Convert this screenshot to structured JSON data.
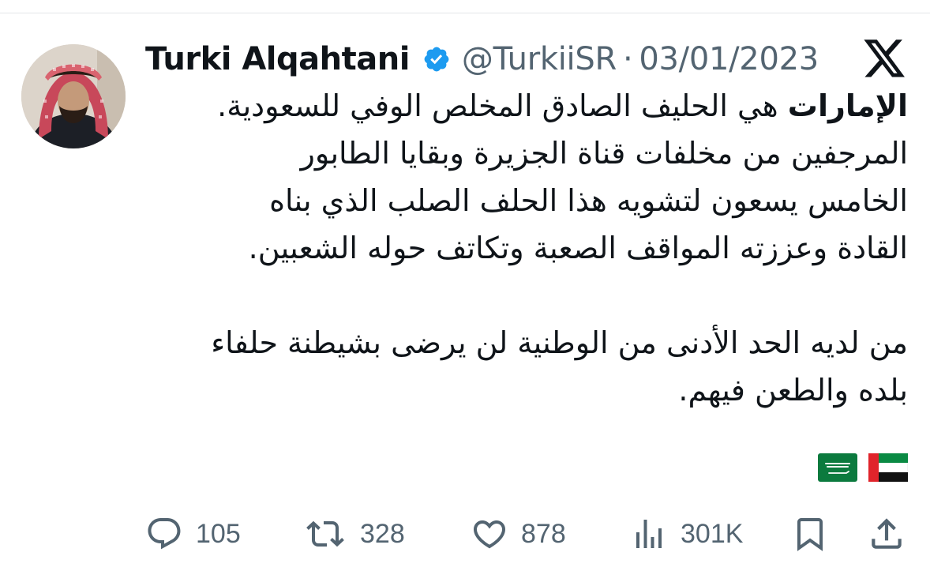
{
  "tweet": {
    "author_name": "Turki Alqahtani",
    "verified_icon": "verified-badge-icon",
    "handle": "@TurkiiSR",
    "separator": "·",
    "date": "03/01/2023",
    "platform_logo": "x-logo",
    "body": {
      "lead_bold": "الإمارات",
      "line1_rest": " هي الحليف الصادق المخلص الوفي للسعودية.",
      "line2": "المرجفين من مخلفات قناة الجزيرة وبقايا الطابور",
      "line3": "الخامس يسعون لتشويه هذا الحلف الصلب الذي بناه",
      "line4": "القادة وعززته المواقف الصعبة وتكاتف حوله الشعبين.",
      "line5": "من لديه الحد الأدنى من الوطنية لن يرضى بشيطنة حلفاء",
      "line6": "بلده والطعن فيهم."
    },
    "flags": [
      "uae-flag",
      "saudi-flag"
    ],
    "colors": {
      "text": "#0f1419",
      "secondary": "#536471",
      "verified": "#1d9bf0"
    }
  },
  "actions": {
    "reply": {
      "icon": "reply-icon",
      "count": "105"
    },
    "retweet": {
      "icon": "retweet-icon",
      "count": "328"
    },
    "like": {
      "icon": "heart-icon",
      "count": "878"
    },
    "views": {
      "icon": "views-icon",
      "count": "301K"
    },
    "bookmark": {
      "icon": "bookmark-icon"
    },
    "share": {
      "icon": "share-icon"
    }
  }
}
